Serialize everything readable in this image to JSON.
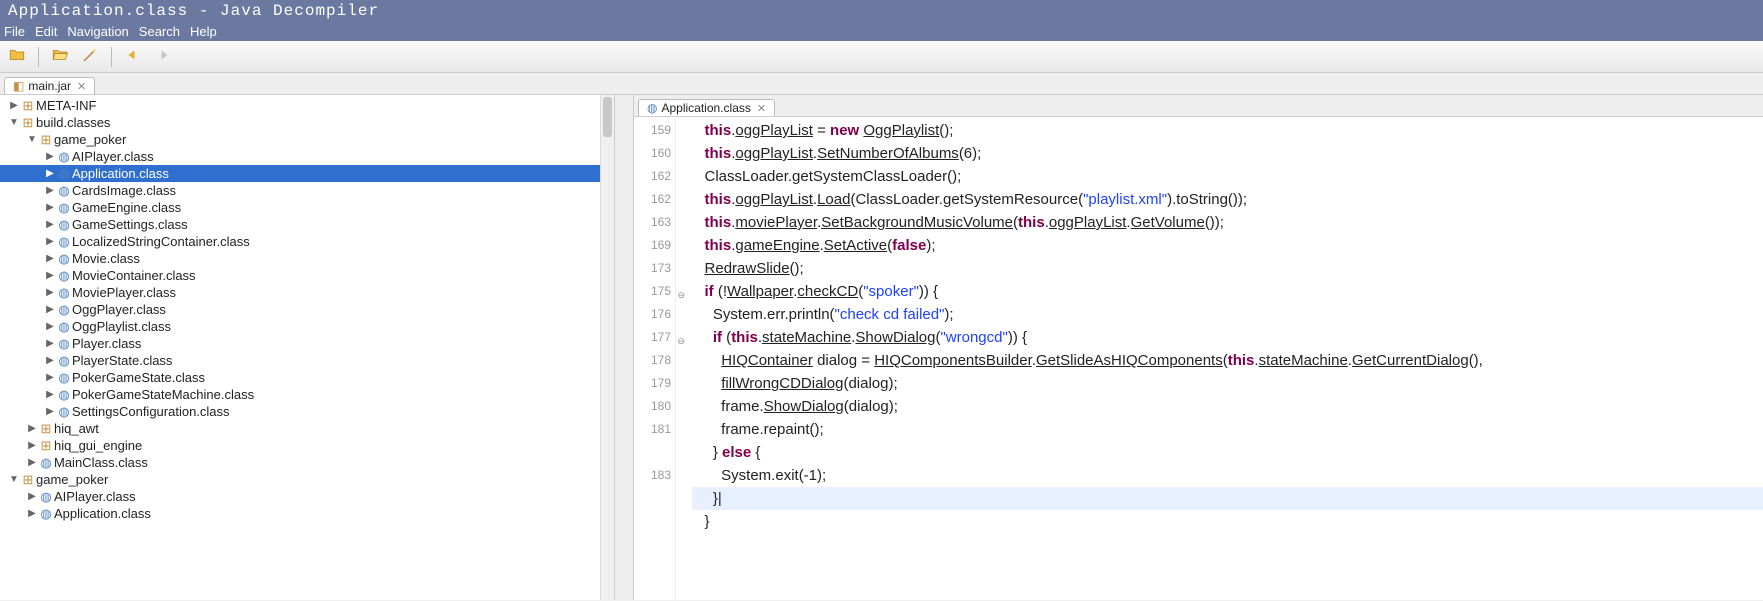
{
  "title": "Application.class - Java Decompiler",
  "menubar": [
    "File",
    "Edit",
    "Navigation",
    "Search",
    "Help"
  ],
  "toolbar": {
    "icons": [
      "open-icon",
      "open-folder-icon",
      "wizard-icon",
      "back-icon",
      "forward-icon"
    ]
  },
  "sidebar_tab": {
    "label": "main.jar",
    "icon": "jar-icon"
  },
  "tree": [
    {
      "d": 0,
      "tw": "▶",
      "ic": "pkg",
      "label": "META-INF"
    },
    {
      "d": 0,
      "tw": "▼",
      "ic": "pkg",
      "label": "build.classes"
    },
    {
      "d": 1,
      "tw": "▼",
      "ic": "pkg",
      "label": "game_poker"
    },
    {
      "d": 2,
      "tw": "▶",
      "ic": "cls",
      "label": "AIPlayer.class"
    },
    {
      "d": 2,
      "tw": "▶",
      "ic": "cls",
      "label": "Application.class",
      "selected": true
    },
    {
      "d": 2,
      "tw": "▶",
      "ic": "cls",
      "label": "CardsImage.class"
    },
    {
      "d": 2,
      "tw": "▶",
      "ic": "cls",
      "label": "GameEngine.class"
    },
    {
      "d": 2,
      "tw": "▶",
      "ic": "cls",
      "label": "GameSettings.class"
    },
    {
      "d": 2,
      "tw": "▶",
      "ic": "cls",
      "label": "LocalizedStringContainer.class"
    },
    {
      "d": 2,
      "tw": "▶",
      "ic": "cls",
      "label": "Movie.class"
    },
    {
      "d": 2,
      "tw": "▶",
      "ic": "cls",
      "label": "MovieContainer.class"
    },
    {
      "d": 2,
      "tw": "▶",
      "ic": "cls",
      "label": "MoviePlayer.class"
    },
    {
      "d": 2,
      "tw": "▶",
      "ic": "cls",
      "label": "OggPlayer.class"
    },
    {
      "d": 2,
      "tw": "▶",
      "ic": "cls",
      "label": "OggPlaylist.class"
    },
    {
      "d": 2,
      "tw": "▶",
      "ic": "cls",
      "label": "Player.class"
    },
    {
      "d": 2,
      "tw": "▶",
      "ic": "cls",
      "label": "PlayerState.class"
    },
    {
      "d": 2,
      "tw": "▶",
      "ic": "cls",
      "label": "PokerGameState.class"
    },
    {
      "d": 2,
      "tw": "▶",
      "ic": "cls",
      "label": "PokerGameStateMachine.class"
    },
    {
      "d": 2,
      "tw": "▶",
      "ic": "cls",
      "label": "SettingsConfiguration.class"
    },
    {
      "d": 1,
      "tw": "▶",
      "ic": "pkg",
      "label": "hiq_awt"
    },
    {
      "d": 1,
      "tw": "▶",
      "ic": "pkg",
      "label": "hiq_gui_engine"
    },
    {
      "d": 1,
      "tw": "▶",
      "ic": "cls",
      "label": "MainClass.class"
    },
    {
      "d": 0,
      "tw": "▼",
      "ic": "pkg",
      "label": "game_poker"
    },
    {
      "d": 1,
      "tw": "▶",
      "ic": "cls",
      "label": "AIPlayer.class"
    },
    {
      "d": 1,
      "tw": "▶",
      "ic": "cls",
      "label": "Application.class"
    }
  ],
  "editor_tab": {
    "label": "Application.class",
    "icon": "class-icon"
  },
  "line_numbers": [
    "159",
    "160",
    "162",
    "162",
    "163",
    "169",
    "173",
    "175",
    "176",
    "177",
    "178",
    "179",
    "180",
    "181",
    "",
    "183",
    "",
    ""
  ],
  "fold_markers": {
    "7": true,
    "9": true
  },
  "code_lines": [
    "   <k>this</k>.<u>oggPlayList</u> = <k>new</k> <u>OggPlaylist</u>();",
    "   <k>this</k>.<u>oggPlayList</u>.<u>SetNumberOfAlbums</u>(6);",
    "   ClassLoader.getSystemClassLoader();",
    "   <k>this</k>.<u>oggPlayList</u>.<u>Load</u>(ClassLoader.getSystemResource(<s>\"playlist.xml\"</s>).toString());",
    "   <k>this</k>.<u>moviePlayer</u>.<u>SetBackgroundMusicVolume</u>(<k>this</k>.<u>oggPlayList</u>.<u>GetVolume</u>());",
    "   <k>this</k>.<u>gameEngine</u>.<u>SetActive</u>(<k>false</k>);",
    "   <u>RedrawSlide</u>();",
    "   <k>if</k> (!<u>Wallpaper</u>.<u>checkCD</u>(<s>\"spoker\"</s>)) {",
    "     System.err.println(<s>\"check cd failed\"</s>);",
    "     <k>if</k> (<k>this</k>.<u>stateMachine</u>.<u>ShowDialog</u>(<s>\"wrongcd\"</s>)) {",
    "       <u>HIQContainer</u> dialog = <u>HIQComponentsBuilder</u>.<u>GetSlideAsHIQComponents</u>(<k>this</k>.<u>stateMachine</u>.<u>GetCurrentDialog</u>(),",
    "       <u>fillWrongCDDialog</u>(dialog);",
    "       frame.<u>ShowDialog</u>(dialog);",
    "       frame.repaint();",
    "     } <k>else</k> {",
    "       System.exit(-1);",
    "     }|",
    "   }"
  ],
  "highlighted_line": 16
}
